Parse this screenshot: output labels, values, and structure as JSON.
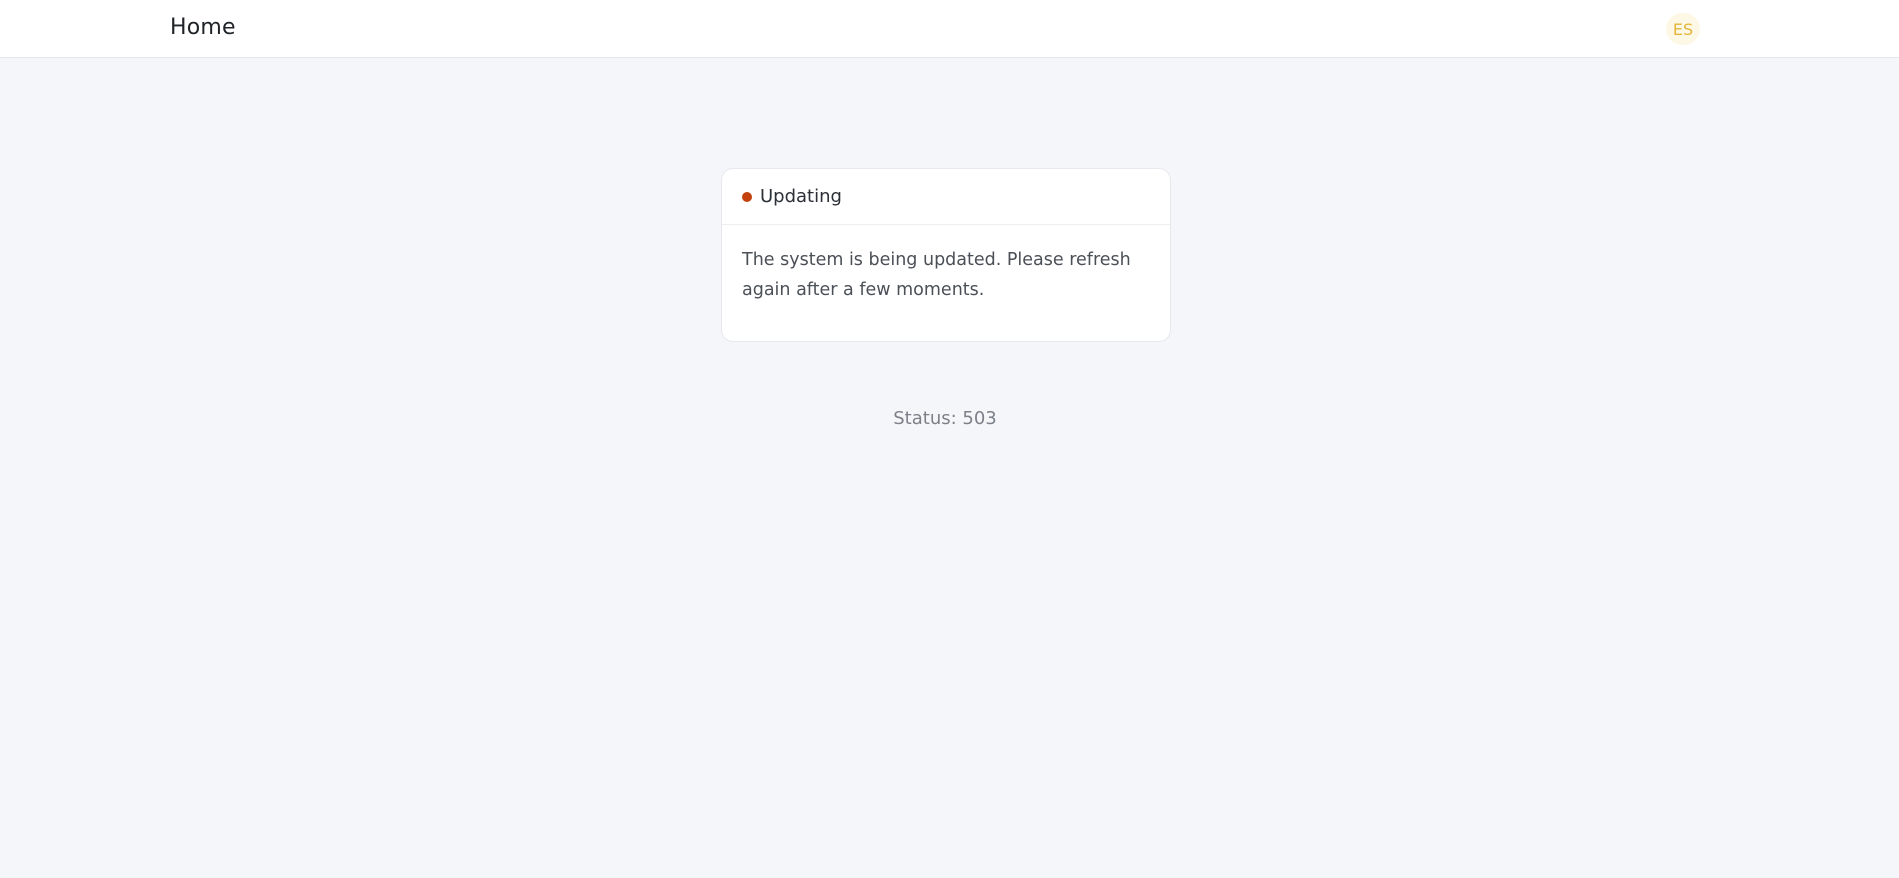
{
  "header": {
    "home_label": "Home",
    "language_code": "ES"
  },
  "notice": {
    "title": "Updating",
    "message": "The system is being updated. Please refresh again after a few moments.",
    "status_color": "#c2410c"
  },
  "footer": {
    "status_text": "Status: 503"
  },
  "colors": {
    "background": "#f5f6f9",
    "language_badge_bg": "#fdf8e6",
    "language_badge_text": "#e4b43b"
  }
}
